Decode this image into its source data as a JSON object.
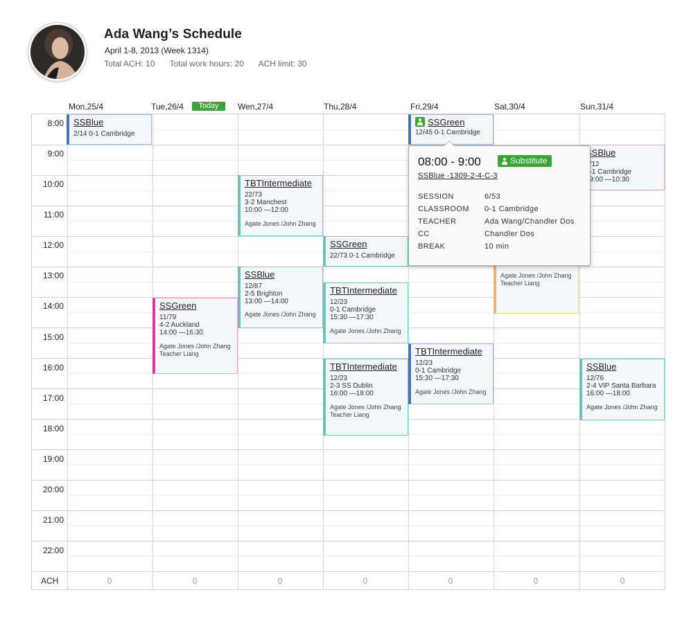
{
  "header": {
    "title": "Ada Wang’s Schedule",
    "subtitle": "April 1-8, 2013 (Week 1314)",
    "total_ach": "Total ACH: 10",
    "total_hours": "Total work hours: 20",
    "ach_limit": "ACH limit: 30"
  },
  "days": [
    "Mon,25/4",
    "Tue,26/4",
    "Wen,27/4",
    "Thu,28/4",
    "Fri,29/4",
    "Sat,30/4",
    "Sun,31/4"
  ],
  "today_label": "Today",
  "times": [
    "8:00",
    "9:00",
    "10:00",
    "11:00",
    "12:00",
    "13:00",
    "14:00",
    "15:00",
    "16:00",
    "17:00",
    "18:00",
    "19:00",
    "20:00",
    "21:00",
    "22:00"
  ],
  "ach": {
    "label": "ACH",
    "values": [
      "0",
      "0",
      "0",
      "0",
      "0",
      "0",
      "0"
    ]
  },
  "events": {
    "mon_ssblue": {
      "title": "SSBlue",
      "line1": "2/14   0-1 Cambridge"
    },
    "fri_ssgreen": {
      "title": "SSGreen",
      "line1": "12/45   0-1 Cambridge"
    },
    "sun_ssblue_a": {
      "title": "SSBlue",
      "line1": "9/12",
      "line2": "0-1 Cambridge",
      "line3": "09:00 —10:30"
    },
    "wed_tbt": {
      "title": "TBTIntermediate",
      "line1": "22/73",
      "line2": "3-2 Manchest",
      "line3": "10:00 —12:00",
      "people": "Agate Jones /John Zhang"
    },
    "thu_ssgreen": {
      "title": "SSGreen",
      "line1": "22/73   0-1 Cambridge"
    },
    "wed_ssblue": {
      "title": "SSBlue",
      "line1": "12/87",
      "line2": "2-5 Brighton",
      "line3": "13:00 —14:00",
      "people": "Agate Jones /John Zhang"
    },
    "sat_event": {
      "people": "Agate Jones /John Zhang",
      "people2": "Teacher Liang"
    },
    "thu_tbt_a": {
      "title": "TBTIntermediate",
      "line1": "12/23",
      "line2": "0-1 Cambridge",
      "line3": "15:30 —17:30",
      "people": "Agate Jones /John Zhang"
    },
    "tue_ssgreen": {
      "title": "SSGreen",
      "line1": "11/79",
      "line2": "4-2 Auckland",
      "line3": "14:00 —16:30",
      "people": "Agate Jones /John Zhang",
      "people2": "Teacher Liang"
    },
    "fri_tbt": {
      "title": "TBTIntermediate",
      "line1": "12/23",
      "line2": "0-1 Cambridge",
      "line3": "15:30 —17:30",
      "people": "Agate Jones /John Zhang"
    },
    "thu_tbt_b": {
      "title": "TBTIntermediate",
      "line1": "12/23",
      "line2": "2-3 SS Dublin",
      "line3": "16:00 —18:00",
      "people": "Agate Jones /John Zhang",
      "people2": "Teacher Liang"
    },
    "sun_ssblue_b": {
      "title": "SSBlue",
      "line1": "12/76",
      "line2": "2-4 VIP Santa Barbara",
      "line3": "16:00 —18:00",
      "people": "Agate Jones /John Zhang"
    }
  },
  "popover": {
    "time": "08:00 - 9:00",
    "badge": "Substitute",
    "code": "SSBlue -1309-2-4-C-3",
    "rows": [
      {
        "key": "SESSION",
        "value": "6/53"
      },
      {
        "key": "CLASSROOM",
        "value": "0-1 Cambridge"
      },
      {
        "key": "TEACHER",
        "value": "Ada Wang/Chandler Dos"
      },
      {
        "key": "CC",
        "value": "Chandler Dos"
      },
      {
        "key": "BREAK",
        "value": "10 min"
      }
    ]
  },
  "colors": {
    "today_green": "#3aa535",
    "blue_accent": "#4a73b5",
    "teal_accent": "#6cc1b9",
    "magenta_accent": "#e233ad",
    "orange_accent": "#f0b27c"
  }
}
